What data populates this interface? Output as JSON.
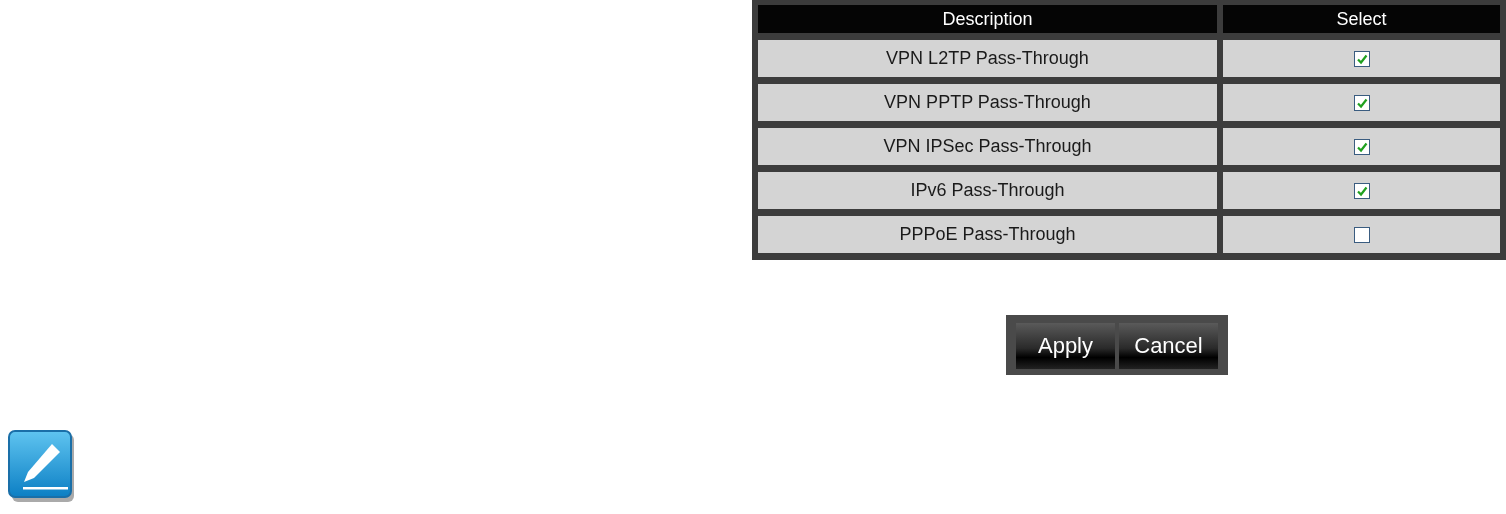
{
  "table": {
    "columns": [
      "Description",
      "Select"
    ],
    "rows": [
      {
        "description": "VPN L2TP Pass-Through",
        "checked": true
      },
      {
        "description": "VPN PPTP Pass-Through",
        "checked": true
      },
      {
        "description": "VPN IPSec Pass-Through",
        "checked": true
      },
      {
        "description": "IPv6 Pass-Through",
        "checked": true
      },
      {
        "description": "PPPoE Pass-Through",
        "checked": false
      }
    ]
  },
  "buttons": [
    "Apply",
    "Cancel"
  ]
}
